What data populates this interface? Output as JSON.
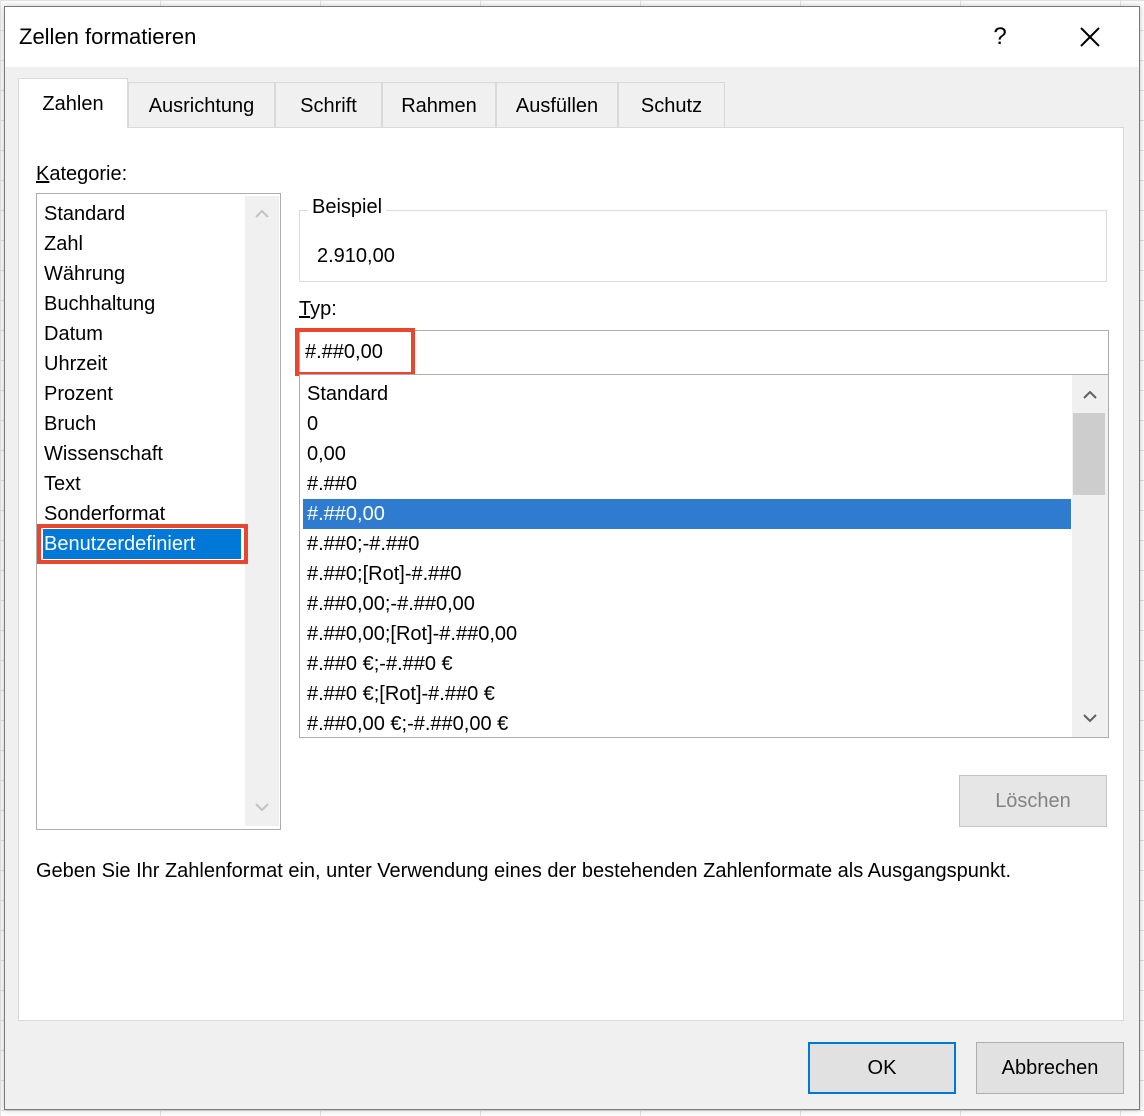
{
  "dialog": {
    "title": "Zellen formatieren",
    "help_label": "?",
    "close_icon": "close-icon"
  },
  "tabs": [
    {
      "label": "Zahlen",
      "active": true
    },
    {
      "label": "Ausrichtung",
      "active": false
    },
    {
      "label": "Schrift",
      "active": false
    },
    {
      "label": "Rahmen",
      "active": false
    },
    {
      "label": "Ausfüllen",
      "active": false
    },
    {
      "label": "Schutz",
      "active": false
    }
  ],
  "category": {
    "label_accel": "K",
    "label_rest": "ategorie:",
    "items": [
      "Standard",
      "Zahl",
      "Währung",
      "Buchhaltung",
      "Datum",
      "Uhrzeit",
      "Prozent",
      "Bruch",
      "Wissenschaft",
      "Text",
      "Sonderformat",
      "Benutzerdefiniert"
    ],
    "selected": "Benutzerdefiniert"
  },
  "sample": {
    "legend": "Beispiel",
    "value": "2.910,00"
  },
  "type": {
    "label_accel": "T",
    "label_rest": "yp:",
    "value": "#.##0,00",
    "formats": [
      "Standard",
      "0",
      "0,00",
      "#.##0",
      "#.##0,00",
      "#.##0;-#.##0",
      "#.##0;[Rot]-#.##0",
      "#.##0,00;-#.##0,00",
      "#.##0,00;[Rot]-#.##0,00",
      "#.##0 €;-#.##0 €",
      "#.##0 €;[Rot]-#.##0 €",
      "#.##0,00 €;-#.##0,00 €"
    ],
    "selected": "#.##0,00"
  },
  "buttons": {
    "delete": "Löschen",
    "ok": "OK",
    "cancel": "Abbrechen"
  },
  "description": "Geben Sie Ihr Zahlenformat ein, unter Verwendung eines der bestehenden Zahlenformate als Ausgangspunkt.",
  "colors": {
    "highlight": "#e8462d",
    "selection": "#0078d7"
  }
}
